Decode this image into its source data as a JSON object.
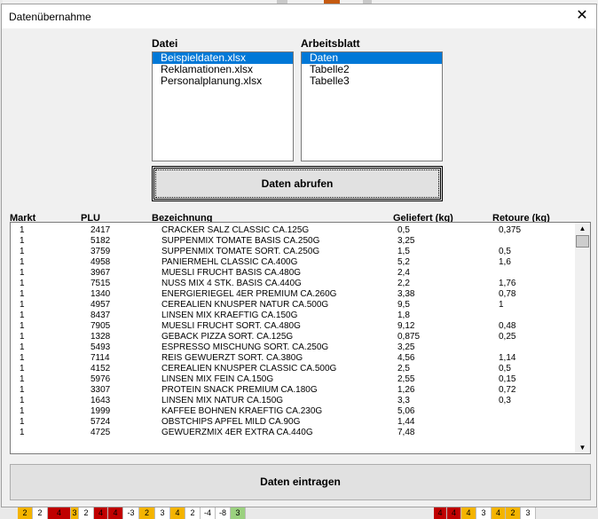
{
  "dialog": {
    "title": "Datenübernahme",
    "close_glyph": "✕"
  },
  "datei": {
    "label": "Datei",
    "items": [
      "Beispieldaten.xlsx",
      "Reklamationen.xlsx",
      "Personalplanung.xlsx"
    ],
    "selected": "Beispieldaten.xlsx"
  },
  "arbeitsblatt": {
    "label": "Arbeitsblatt",
    "items": [
      "Daten",
      "Tabelle2",
      "Tabelle3"
    ],
    "selected": "Daten"
  },
  "buttons": {
    "abrufen": "Daten abrufen",
    "eintragen": "Daten eintragen"
  },
  "columns": {
    "markt": "Markt",
    "plu": "PLU",
    "bezeichnung": "Bezeichnung",
    "geliefert": "Geliefert (kg)",
    "retoure": "Retoure (kg)"
  },
  "rows": [
    [
      "1",
      "2417",
      "CRACKER SALZ CLASSIC CA.125G",
      "0,5",
      "0,375"
    ],
    [
      "1",
      "5182",
      "SUPPENMIX TOMATE BASIS CA.250G",
      "3,25",
      ""
    ],
    [
      "1",
      "3759",
      "SUPPENMIX TOMATE SORT. CA.250G",
      "1,5",
      "0,5"
    ],
    [
      "1",
      "4958",
      "PANIERMEHL CLASSIC CA.400G",
      "5,2",
      "1,6"
    ],
    [
      "1",
      "3967",
      "MUESLI FRUCHT BASIS CA.480G",
      "2,4",
      ""
    ],
    [
      "1",
      "7515",
      "NUSS MIX 4 STK. BASIS CA.440G",
      "2,2",
      "1,76"
    ],
    [
      "1",
      "1340",
      "ENERGIERIEGEL 4ER PREMIUM CA.260G",
      "3,38",
      "0,78"
    ],
    [
      "1",
      "4957",
      "CEREALIEN KNUSPER NATUR CA.500G",
      "9,5",
      "1"
    ],
    [
      "1",
      "8437",
      "LINSEN MIX KRAEFTIG CA.150G",
      "1,8",
      ""
    ],
    [
      "1",
      "7905",
      "MUESLI FRUCHT SORT. CA.480G",
      "9,12",
      "0,48"
    ],
    [
      "1",
      "1328",
      "GEBACK PIZZA SORT. CA.125G",
      "0,875",
      "0,25"
    ],
    [
      "1",
      "5493",
      "ESPRESSO MISCHUNG SORT. CA.250G",
      "3,25",
      ""
    ],
    [
      "1",
      "7114",
      "REIS GEWUERZT SORT. CA.380G",
      "4,56",
      "1,14"
    ],
    [
      "1",
      "4152",
      "CEREALIEN KNUSPER CLASSIC CA.500G",
      "2,5",
      "0,5"
    ],
    [
      "1",
      "5976",
      "LINSEN MIX FEIN CA.150G",
      "2,55",
      "0,15"
    ],
    [
      "1",
      "3307",
      "PROTEIN SNACK PREMIUM CA.180G",
      "1,26",
      "0,72"
    ],
    [
      "1",
      "1643",
      "LINSEN MIX NATUR CA.150G",
      "3,3",
      "0,3"
    ],
    [
      "1",
      "1999",
      "KAFFEE BOHNEN KRAEFTIG CA.230G",
      "5,06",
      ""
    ],
    [
      "1",
      "5724",
      "OBSTCHIPS APFEL MILD CA.90G",
      "1,44",
      ""
    ],
    [
      "1",
      "4725",
      "GEWUERZMIX 4ER EXTRA CA.440G",
      "7,48",
      ""
    ]
  ],
  "scrollbar": {
    "up_glyph": "▲",
    "down_glyph": "▼"
  },
  "background": {
    "bottom_cells": [
      {
        "text": "2",
        "color": "#f4b400"
      },
      {
        "text": "2",
        "color": "#ffffff"
      },
      {
        "text": "4",
        "color": "#c00000"
      },
      {
        "text": "3",
        "color": "#f4b400"
      },
      {
        "text": "2",
        "color": "#ffffff"
      },
      {
        "text": "4",
        "color": "#c00000"
      },
      {
        "text": "4",
        "color": "#c00000"
      },
      {
        "text": "-3",
        "color": "#ffffff"
      },
      {
        "text": "2",
        "color": "#f4b400"
      },
      {
        "text": "3",
        "color": "#ffffff"
      },
      {
        "text": "4",
        "color": "#f4b400"
      },
      {
        "text": "2",
        "color": "#ffffff"
      },
      {
        "text": "-4",
        "color": "#ffffff"
      },
      {
        "text": "-8",
        "color": "#ffffff"
      },
      {
        "text": "3",
        "color": "#9bd17f"
      },
      {
        "text": "4",
        "color": "#c00000"
      },
      {
        "text": "4",
        "color": "#c00000"
      },
      {
        "text": "4",
        "color": "#f4b400"
      },
      {
        "text": "3",
        "color": "#ffffff"
      },
      {
        "text": "4",
        "color": "#f4b400"
      },
      {
        "text": "2",
        "color": "#f4b400"
      },
      {
        "text": "3",
        "color": "#ffffff"
      }
    ]
  }
}
